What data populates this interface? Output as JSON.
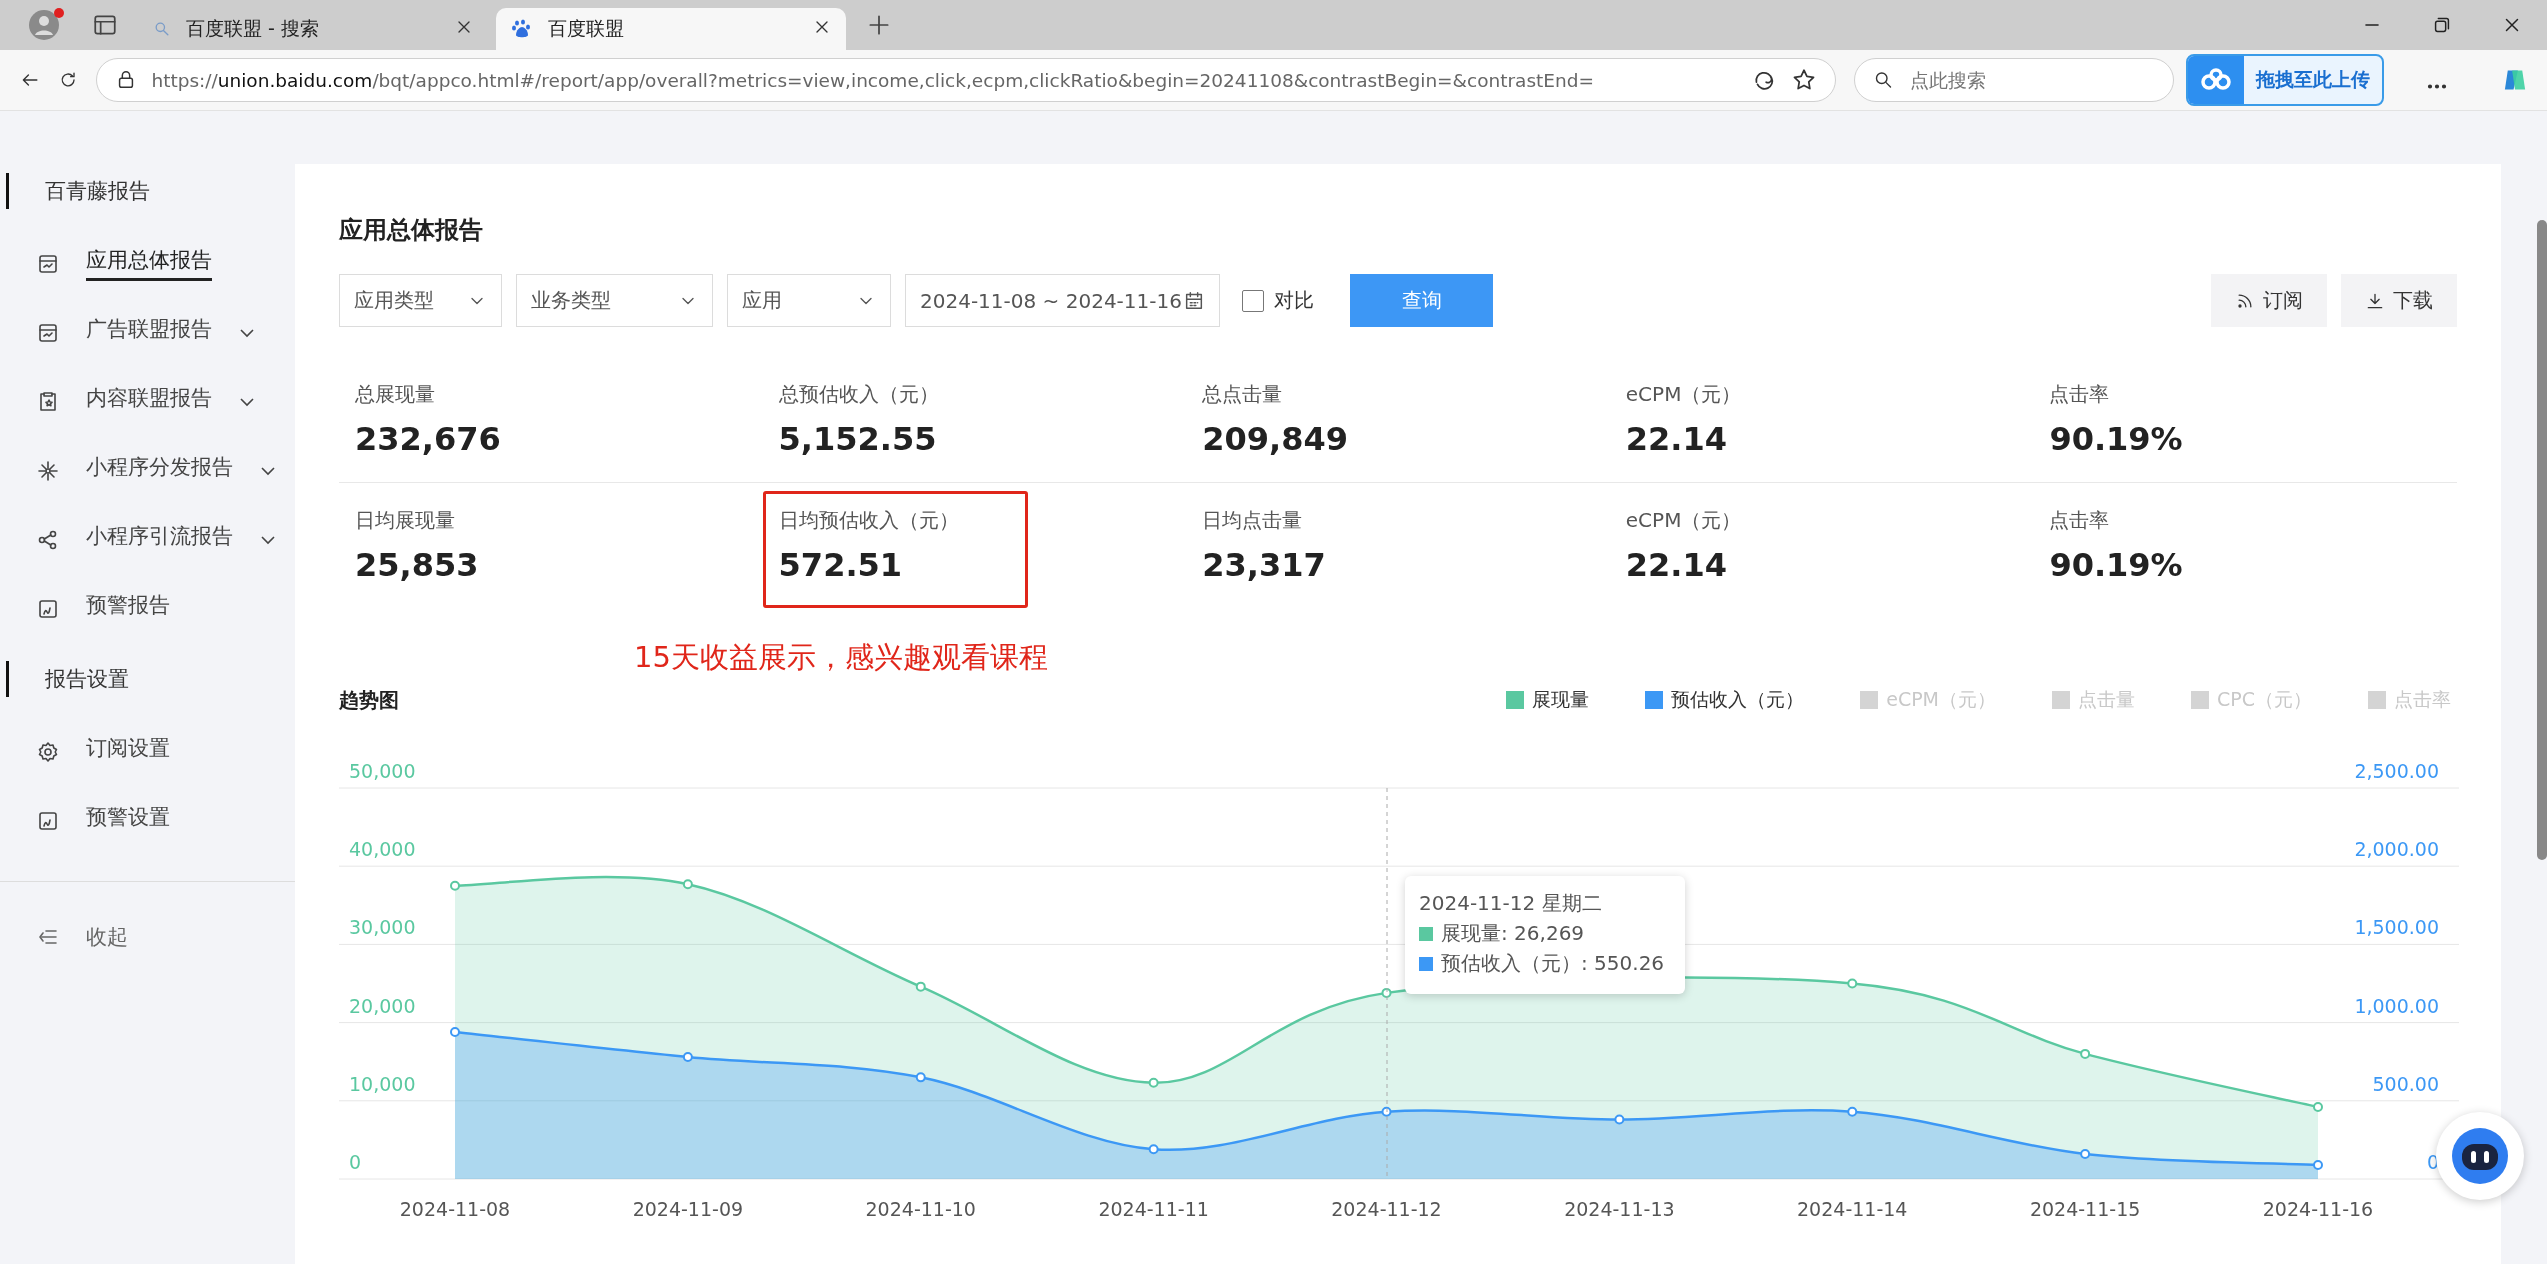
{
  "browser": {
    "tabs": [
      {
        "title": "百度联盟 - 搜索",
        "selected": false
      },
      {
        "title": "百度联盟",
        "selected": true
      }
    ],
    "url": {
      "scheme": "https://",
      "host": "union.baidu.com",
      "path": "/bqt/appco.html#/report/app/overall?metrics=view,income,click,ecpm,clickRatio&begin=20241108&contrastBegin=&contrastEnd="
    },
    "search": {
      "placeholder": "点此搜索"
    },
    "upload_button": "拖拽至此上传"
  },
  "sidebar": {
    "sections": [
      {
        "title": "百青藤报告",
        "items": [
          {
            "label": "应用总体报告",
            "selected": true,
            "expandable": false
          },
          {
            "label": "广告联盟报告",
            "selected": false,
            "expandable": true
          },
          {
            "label": "内容联盟报告",
            "selected": false,
            "expandable": true
          },
          {
            "label": "小程序分发报告",
            "selected": false,
            "expandable": true
          },
          {
            "label": "小程序引流报告",
            "selected": false,
            "expandable": true
          },
          {
            "label": "预警报告",
            "selected": false,
            "expandable": false
          }
        ]
      },
      {
        "title": "报告设置",
        "items": [
          {
            "label": "订阅设置",
            "selected": false,
            "expandable": false
          },
          {
            "label": "预警设置",
            "selected": false,
            "expandable": false
          }
        ]
      }
    ],
    "collapse": "收起"
  },
  "page": {
    "title": "应用总体报告",
    "filters": [
      {
        "placeholder": "应用类型"
      },
      {
        "placeholder": "业务类型"
      },
      {
        "placeholder": "应用"
      }
    ],
    "date_range": "2024-11-08 ~ 2024-11-16",
    "compare": {
      "label": "对比",
      "checked": false
    },
    "query_button": "查询",
    "actions": [
      {
        "label": "订阅"
      },
      {
        "label": "下载"
      }
    ],
    "stats": [
      [
        {
          "label": "总展现量",
          "value": "232,676",
          "boxed": false
        },
        {
          "label": "总预估收入（元）",
          "value": "5,152.55",
          "boxed": false
        },
        {
          "label": "总点击量",
          "value": "209,849",
          "boxed": false
        },
        {
          "label": "eCPM（元）",
          "value": "22.14",
          "boxed": false
        },
        {
          "label": "点击率",
          "value": "90.19%",
          "boxed": false
        }
      ],
      [
        {
          "label": "日均展现量",
          "value": "25,853",
          "boxed": false
        },
        {
          "label": "日均预估收入（元）",
          "value": "572.51",
          "boxed": true
        },
        {
          "label": "日均点击量",
          "value": "23,317",
          "boxed": false
        },
        {
          "label": "eCPM（元）",
          "value": "22.14",
          "boxed": false
        },
        {
          "label": "点击率",
          "value": "90.19%",
          "boxed": false
        }
      ]
    ],
    "annotation": "15天收益展示，感兴趣观看课程"
  },
  "trend": {
    "title": "趋势图",
    "legend": [
      {
        "selected": true
      },
      {
        "selected": true
      },
      {
        "label": "eCPM（元）",
        "selected": false
      },
      {
        "label": "点击量",
        "selected": false
      },
      {
        "label": "CPC（元）",
        "selected": false
      },
      {
        "label": "点击率",
        "selected": false
      }
    ],
    "chart_data": {
      "type": "area",
      "grid": true,
      "categories": [
        "2024-11-08",
        "2024-11-09",
        "2024-11-10",
        "2024-11-11",
        "2024-11-12",
        "2024-11-13",
        "2024-11-14",
        "2024-11-15",
        "2024-11-16"
      ],
      "series": [
        {
          "name": "展现量",
          "color": "#5ac8a0",
          "values": [
            37500,
            37700,
            24600,
            12300,
            23800,
            null,
            25000,
            16000,
            9200
          ]
        },
        {
          "name": "预估收入（元）",
          "color": "#3c98f5",
          "axis": "y2",
          "values": [
            940,
            780,
            650,
            190,
            430,
            380,
            430,
            160,
            90
          ]
        }
      ],
      "ylim": [
        0,
        50000
      ],
      "y2lim": [
        0,
        2500
      ],
      "yticks": [
        {
          "value": 0,
          "label": "0"
        },
        {
          "value": 10000,
          "label": "10,000"
        },
        {
          "value": 20000,
          "label": "20,000"
        },
        {
          "value": 30000,
          "label": "30,000"
        },
        {
          "value": 40000,
          "label": "40,000"
        },
        {
          "value": 50000,
          "label": "50,000"
        }
      ],
      "y2ticks": [
        {
          "value": 0,
          "label": "0"
        },
        {
          "value": 500,
          "label": "500.00"
        },
        {
          "value": 1000,
          "label": "1,000.00"
        },
        {
          "value": 1500,
          "label": "1,500.00"
        },
        {
          "value": 2000,
          "label": "2,000.00"
        },
        {
          "value": 2500,
          "label": "2,500.00"
        }
      ]
    },
    "tooltip": {
      "title": "2024-11-12 星期二",
      "rows": [
        {
          "text": "展现量: 26,269",
          "color": "#5ac8a0"
        },
        {
          "text": "预估收入（元）: 550.26",
          "color": "#3c98f5"
        }
      ]
    }
  }
}
